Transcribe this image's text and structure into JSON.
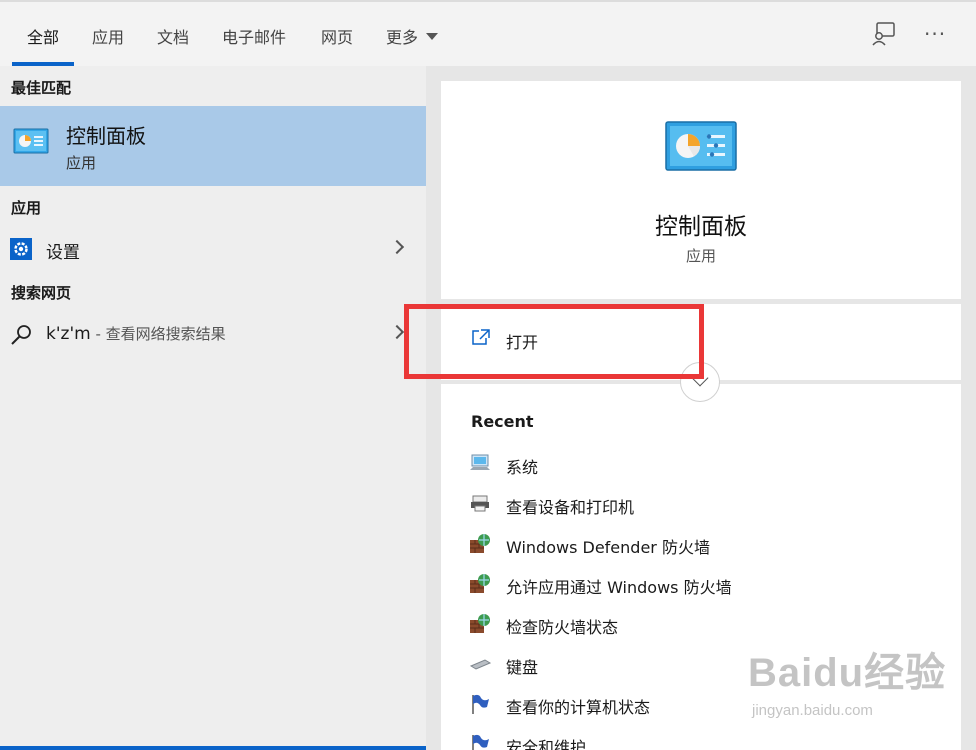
{
  "tabs": [
    {
      "label": "全部",
      "active": true
    },
    {
      "label": "应用"
    },
    {
      "label": "文档"
    },
    {
      "label": "电子邮件"
    },
    {
      "label": "网页"
    },
    {
      "label": "更多"
    }
  ],
  "toolbar": {
    "feedback_icon": "feedback-icon",
    "more_icon": "ellipsis-icon"
  },
  "left": {
    "best_match_heading": "最佳匹配",
    "best_match": {
      "title": "控制面板",
      "subtitle": "应用",
      "icon": "control-panel-icon"
    },
    "apps_heading": "应用",
    "apps": [
      {
        "label": "设置",
        "icon": "gear-icon"
      }
    ],
    "web_heading": "搜索网页",
    "web": [
      {
        "query": "k'z'm",
        "suffix": " - 查看网络搜索结果",
        "icon": "search-icon"
      }
    ]
  },
  "right": {
    "title": "控制面板",
    "subtitle": "应用",
    "open_label": "打开",
    "recent_heading": "Recent",
    "recent": [
      {
        "label": "系统",
        "icon": "system-icon"
      },
      {
        "label": "查看设备和打印机",
        "icon": "printer-icon"
      },
      {
        "label": "Windows Defender 防火墙",
        "icon": "firewall-icon"
      },
      {
        "label": "允许应用通过 Windows 防火墙",
        "icon": "firewall-icon"
      },
      {
        "label": "检查防火墙状态",
        "icon": "firewall-icon"
      },
      {
        "label": "键盘",
        "icon": "keyboard-icon"
      },
      {
        "label": "查看你的计算机状态",
        "icon": "flag-icon"
      },
      {
        "label": "安全和维护",
        "icon": "flag-icon"
      }
    ]
  },
  "watermark": {
    "text": "Baidu经验",
    "url": "jingyan.baidu.com"
  },
  "colors": {
    "accent": "#0a63c9",
    "selected": "#a9c9e8",
    "highlight": "#ea3737"
  }
}
